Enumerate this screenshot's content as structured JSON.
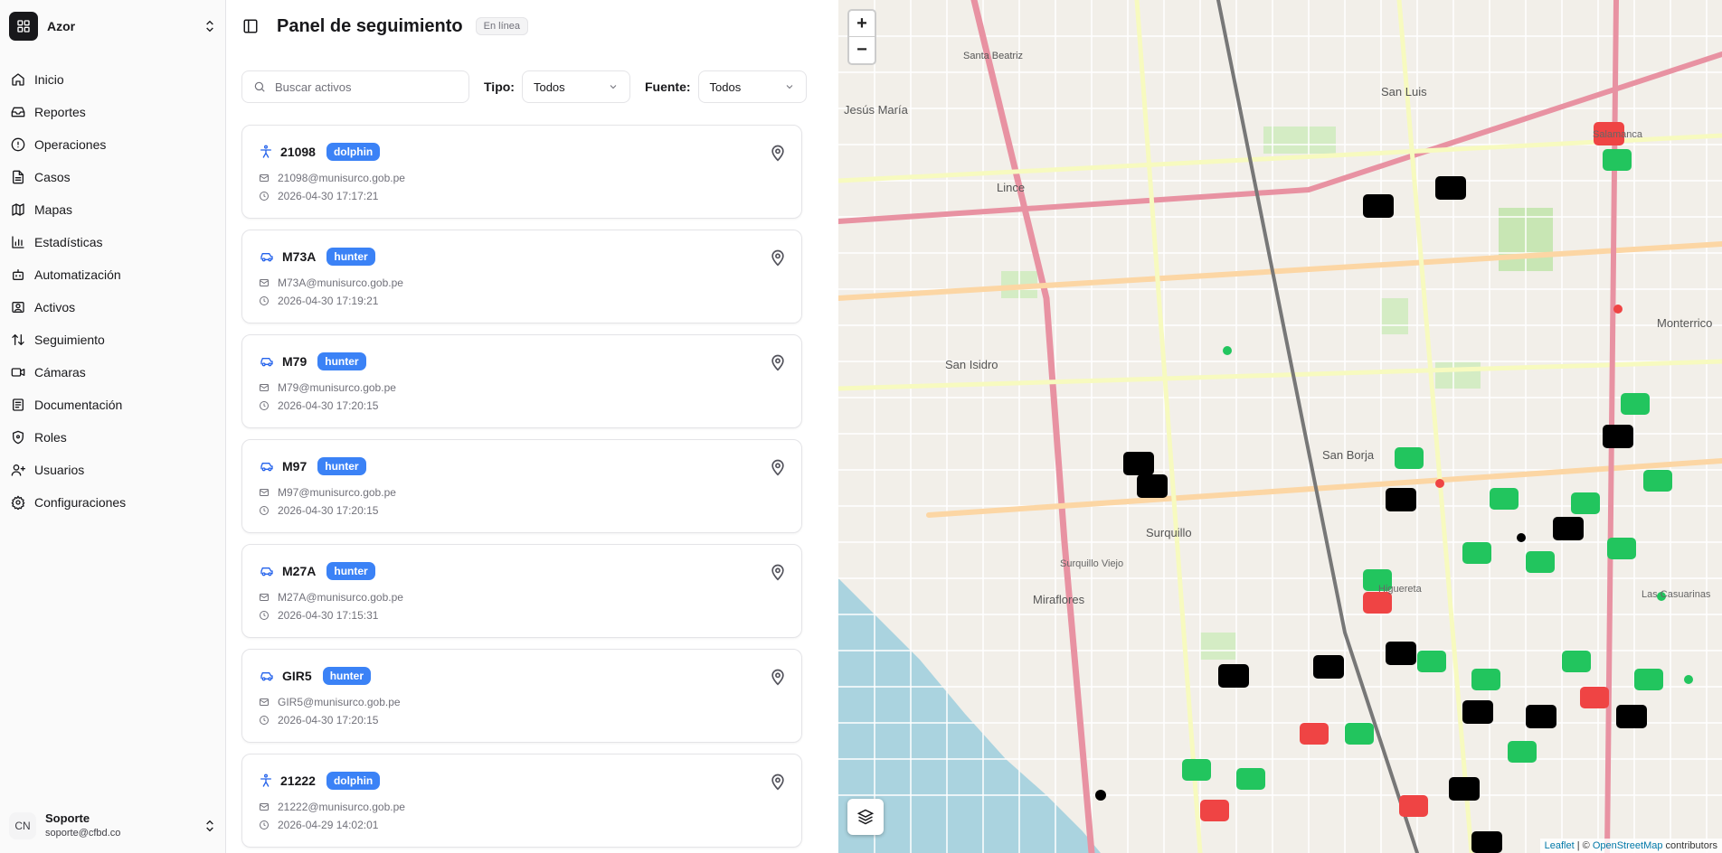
{
  "sidebar": {
    "brand": "Azor",
    "items": [
      {
        "label": "Inicio",
        "icon": "home-icon"
      },
      {
        "label": "Reportes",
        "icon": "inbox-icon"
      },
      {
        "label": "Operaciones",
        "icon": "alert-circle-icon"
      },
      {
        "label": "Casos",
        "icon": "file-text-icon"
      },
      {
        "label": "Mapas",
        "icon": "map-icon"
      },
      {
        "label": "Estadísticas",
        "icon": "bar-chart-icon"
      },
      {
        "label": "Automatización",
        "icon": "bot-icon"
      },
      {
        "label": "Activos",
        "icon": "contact-icon"
      },
      {
        "label": "Seguimiento",
        "icon": "arrow-up-down-icon"
      },
      {
        "label": "Cámaras",
        "icon": "video-icon"
      },
      {
        "label": "Documentación",
        "icon": "book-icon"
      },
      {
        "label": "Roles",
        "icon": "shield-icon"
      },
      {
        "label": "Usuarios",
        "icon": "users-icon"
      },
      {
        "label": "Configuraciones",
        "icon": "settings-icon"
      }
    ],
    "user": {
      "initials": "CN",
      "name": "Soporte",
      "email": "soporte@cfbd.co"
    }
  },
  "header": {
    "title": "Panel de seguimiento",
    "status": "En línea"
  },
  "filters": {
    "search_placeholder": "Buscar activos",
    "tipo_label": "Tipo:",
    "tipo_value": "Todos",
    "fuente_label": "Fuente:",
    "fuente_value": "Todos"
  },
  "assets": [
    {
      "name": "21098",
      "type": "dolphin",
      "icon": "person-icon",
      "email": "21098@munisurco.gob.pe",
      "time": "2026-04-30 17:17:21"
    },
    {
      "name": "M73A",
      "type": "hunter",
      "icon": "car-icon",
      "email": "M73A@munisurco.gob.pe",
      "time": "2026-04-30 17:19:21"
    },
    {
      "name": "M79",
      "type": "hunter",
      "icon": "car-icon",
      "email": "M79@munisurco.gob.pe",
      "time": "2026-04-30 17:20:15"
    },
    {
      "name": "M97",
      "type": "hunter",
      "icon": "car-icon",
      "email": "M97@munisurco.gob.pe",
      "time": "2026-04-30 17:20:15"
    },
    {
      "name": "M27A",
      "type": "hunter",
      "icon": "car-icon",
      "email": "M27A@munisurco.gob.pe",
      "time": "2026-04-30 17:15:31"
    },
    {
      "name": "GIR5",
      "type": "hunter",
      "icon": "car-icon",
      "email": "GIR5@munisurco.gob.pe",
      "time": "2026-04-30 17:20:15"
    },
    {
      "name": "21222",
      "type": "dolphin",
      "icon": "person-icon",
      "email": "21222@munisurco.gob.pe",
      "time": "2026-04-29 14:02:01"
    }
  ],
  "map": {
    "zoom_in": "+",
    "zoom_out": "−",
    "labels": [
      "Santa Beatriz",
      "Jesús María",
      "Lince",
      "San Isidro",
      "San Borja",
      "Surquillo",
      "Surquillo Viejo",
      "Miraflores",
      "San Luis",
      "Salamanca",
      "Monterrico",
      "Las Casuarinas",
      "Higuereta"
    ],
    "attribution_leaflet": "Leaflet",
    "attribution_sep": " | © ",
    "attribution_osm": "OpenStreetMap",
    "attribution_tail": " contributors",
    "colors": {
      "online": "#22c55e",
      "alert": "#ef4444",
      "offline": "#000000",
      "badge": "#3b82f6"
    }
  }
}
